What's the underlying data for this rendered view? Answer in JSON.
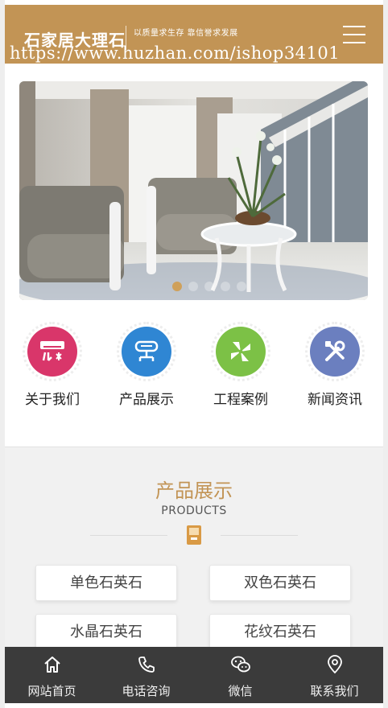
{
  "header": {
    "logo_text": "石家居大理石",
    "slogan": "以质量求生存 靠信誉求发展",
    "watermark": "https://www.huzhan.com/ishop34101"
  },
  "banner": {
    "slides": 5,
    "active_slide": 1
  },
  "quick_nav": [
    {
      "label": "关于我们",
      "icon": "aircon-icon",
      "color": "#d9366a"
    },
    {
      "label": "产品展示",
      "icon": "product-stand-icon",
      "color": "#2f86d3"
    },
    {
      "label": "工程案例",
      "icon": "pinwheel-icon",
      "color": "#7cc146"
    },
    {
      "label": "新闻资讯",
      "icon": "tools-icon",
      "color": "#6b7fbf"
    }
  ],
  "products": {
    "title": "产品展示",
    "subtitle": "PRODUCTS",
    "icon": "tile-icon",
    "accent": "#c29455",
    "categories": [
      "单色石英石",
      "双色石英石",
      "水晶石英石",
      "花纹石英石"
    ]
  },
  "footer": {
    "items": [
      {
        "label": "网站首页",
        "icon": "home-icon"
      },
      {
        "label": "电话咨询",
        "icon": "phone-icon"
      },
      {
        "label": "微信",
        "icon": "wechat-icon"
      },
      {
        "label": "联系我们",
        "icon": "location-icon"
      }
    ]
  }
}
